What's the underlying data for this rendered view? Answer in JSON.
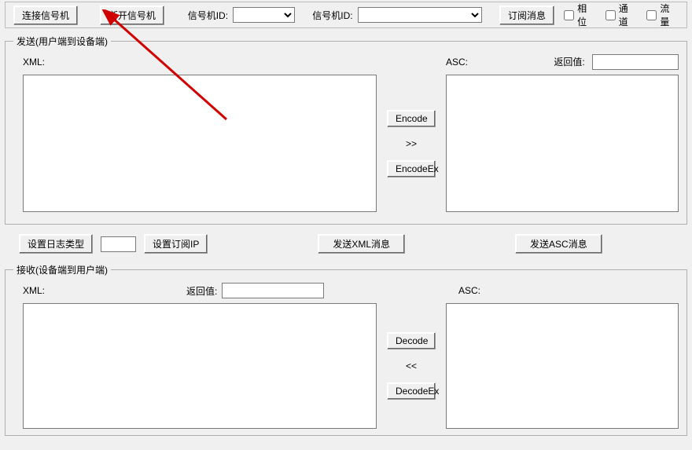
{
  "topbar": {
    "connect_label": "连接信号机",
    "disconnect_label": "断开信号机",
    "id1_label": "信号机ID:",
    "id1_value": "",
    "id2_label": "信号机ID:",
    "id2_value": "",
    "subscribe_label": "订阅消息",
    "chk_phase": "相位",
    "chk_channel": "通道",
    "chk_flow": "流量"
  },
  "send": {
    "legend": "发送(用户端到设备端)",
    "xml_label": "XML:",
    "asc_label": "ASC:",
    "return_label": "返回值:",
    "return_value": "",
    "xml_value": "",
    "asc_value": "",
    "encode_label": "Encode",
    "arrows_label": ">>",
    "encodeex_label": "EncodeEx"
  },
  "mid": {
    "set_log_type": "设置日志类型",
    "log_value": "",
    "set_sub_ip": "设置订阅IP",
    "send_xml": "发送XML消息",
    "send_asc": "发送ASC消息"
  },
  "recv": {
    "legend": "接收(设备端到用户端)",
    "xml_label": "XML:",
    "return_label": "返回值:",
    "return_value": "",
    "asc_label": "ASC:",
    "xml_value": "",
    "asc_value": "",
    "decode_label": "Decode",
    "arrows_label": "<<",
    "decodeex_label": "DecodeEx"
  }
}
